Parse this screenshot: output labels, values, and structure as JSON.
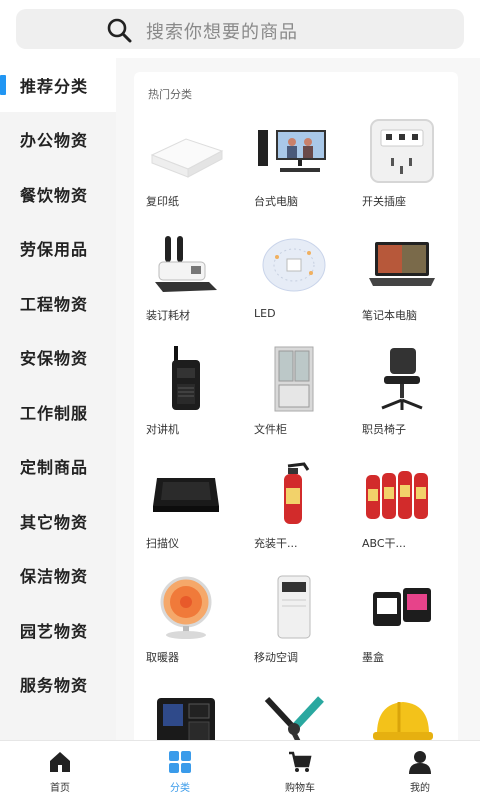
{
  "search": {
    "placeholder": "搜索你想要的商品"
  },
  "sidebar": {
    "items": [
      {
        "label": "推荐分类",
        "active": true
      },
      {
        "label": "办公物资"
      },
      {
        "label": "餐饮物资"
      },
      {
        "label": "劳保用品"
      },
      {
        "label": "工程物资"
      },
      {
        "label": "安保物资"
      },
      {
        "label": "工作制服"
      },
      {
        "label": "定制商品"
      },
      {
        "label": "其它物资"
      },
      {
        "label": "保洁物资"
      },
      {
        "label": "园艺物资"
      },
      {
        "label": "服务物资"
      }
    ]
  },
  "main": {
    "section_title": "热门分类",
    "products": [
      {
        "name": "复印纸",
        "icon": "paper-stack-icon"
      },
      {
        "name": "台式电脑",
        "icon": "desktop-computer-icon"
      },
      {
        "name": "开关插座",
        "icon": "wall-socket-icon"
      },
      {
        "name": "装订耗材",
        "icon": "binding-machine-icon"
      },
      {
        "name": "LED",
        "icon": "led-panel-icon"
      },
      {
        "name": "笔记本电脑",
        "icon": "laptop-icon"
      },
      {
        "name": "对讲机",
        "icon": "walkie-talkie-icon"
      },
      {
        "name": "文件柜",
        "icon": "file-cabinet-icon"
      },
      {
        "name": "职员椅子",
        "icon": "office-chair-icon"
      },
      {
        "name": "扫描仪",
        "icon": "scanner-icon"
      },
      {
        "name": "充装干...",
        "icon": "fire-extinguisher-icon"
      },
      {
        "name": "ABC干...",
        "icon": "extinguisher-group-icon"
      },
      {
        "name": "取暖器",
        "icon": "heater-icon"
      },
      {
        "name": "移动空调",
        "icon": "portable-ac-icon"
      },
      {
        "name": "墨盒",
        "icon": "ink-cartridge-icon"
      },
      {
        "name": "",
        "icon": "attendance-terminal-icon"
      },
      {
        "name": "",
        "icon": "crimping-tool-icon"
      },
      {
        "name": "",
        "icon": "safety-helmet-icon"
      }
    ]
  },
  "tabbar": {
    "items": [
      {
        "label": "首页",
        "icon": "home-icon"
      },
      {
        "label": "分类",
        "icon": "category-grid-icon",
        "active": true
      },
      {
        "label": "购物车",
        "icon": "cart-icon"
      },
      {
        "label": "我的",
        "icon": "user-icon"
      }
    ]
  },
  "colors": {
    "accent": "#3a9bea",
    "sidebar_active_bar": "#2196f3",
    "sidebar_bg": "#f4f4f4"
  }
}
